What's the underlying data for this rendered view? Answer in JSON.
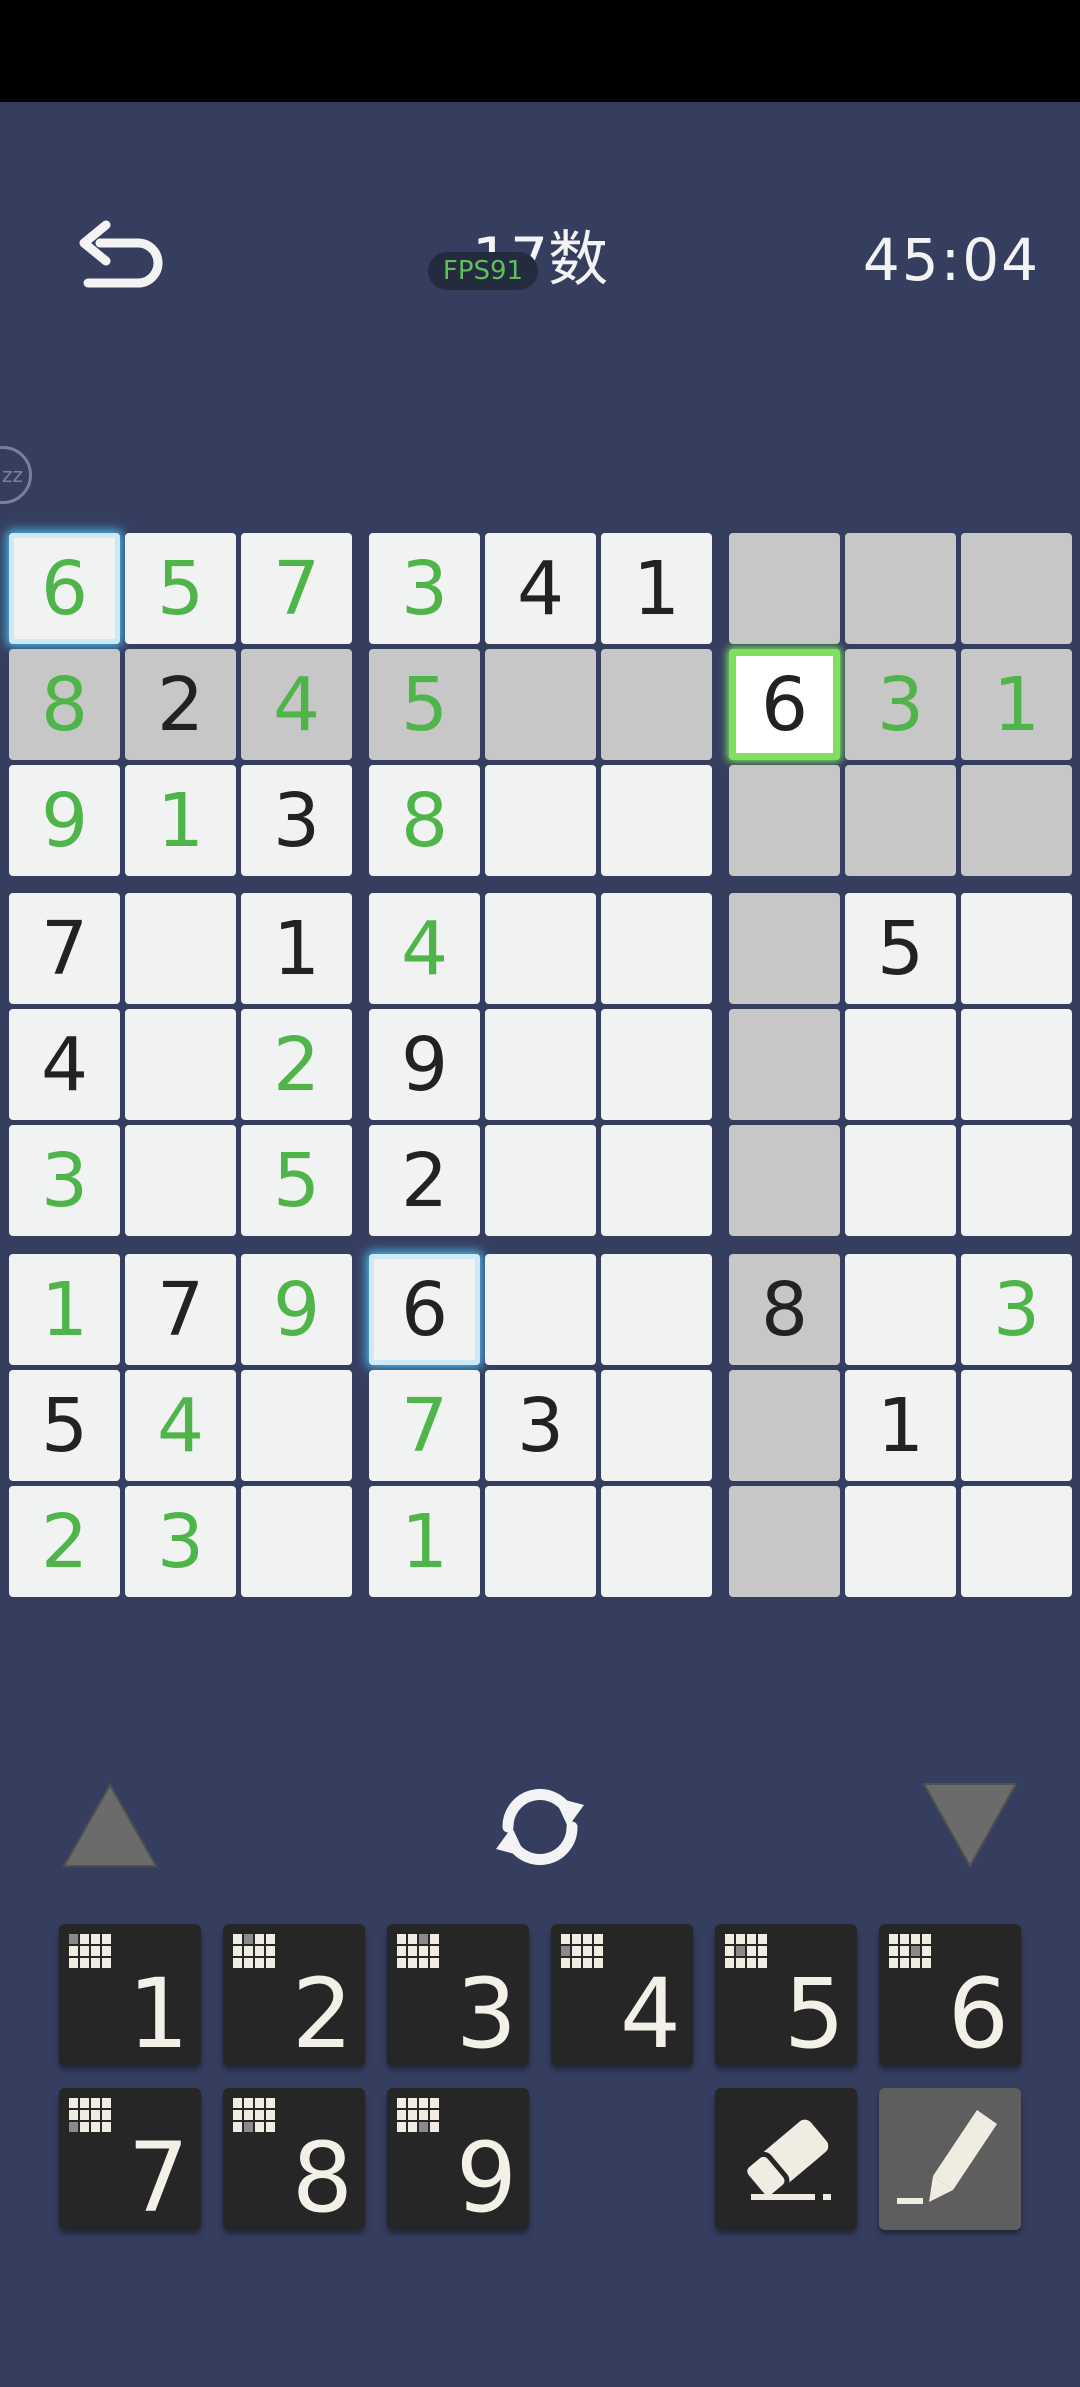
{
  "header": {
    "title": "17数",
    "fps": "FPS91",
    "timer": "45:04",
    "float_badge": "zz"
  },
  "board": {
    "rows": [
      [
        "6",
        "5",
        "7",
        "3",
        "4",
        "1",
        "",
        "",
        ""
      ],
      [
        "8",
        "2",
        "4",
        "5",
        "",
        "",
        "6",
        "3",
        "1"
      ],
      [
        "9",
        "1",
        "3",
        "8",
        "",
        "",
        "",
        "",
        ""
      ],
      [
        "7",
        "",
        "1",
        "4",
        "",
        "",
        "",
        "5",
        ""
      ],
      [
        "4",
        "",
        "2",
        "9",
        "",
        "",
        "",
        "",
        ""
      ],
      [
        "3",
        "",
        "5",
        "2",
        "",
        "",
        "",
        "",
        ""
      ],
      [
        "1",
        "7",
        "9",
        "6",
        "",
        "",
        "8",
        "",
        "3"
      ],
      [
        "5",
        "4",
        "",
        "7",
        "3",
        "",
        "",
        "1",
        ""
      ],
      [
        "2",
        "3",
        "",
        "1",
        "",
        "",
        "",
        "",
        ""
      ]
    ],
    "types": [
      [
        "u",
        "u",
        "u",
        "u",
        "g",
        "g",
        "",
        "",
        ""
      ],
      [
        "u",
        "g",
        "u",
        "u",
        "",
        "",
        "g",
        "u",
        "u"
      ],
      [
        "u",
        "u",
        "g",
        "u",
        "",
        "",
        "",
        "",
        ""
      ],
      [
        "g",
        "",
        "g",
        "u",
        "",
        "",
        "",
        "g",
        ""
      ],
      [
        "g",
        "",
        "u",
        "g",
        "",
        "",
        "",
        "",
        ""
      ],
      [
        "u",
        "",
        "u",
        "g",
        "",
        "",
        "",
        "",
        ""
      ],
      [
        "u",
        "g",
        "u",
        "g",
        "",
        "",
        "g",
        "",
        "u"
      ],
      [
        "g",
        "u",
        "",
        "u",
        "g",
        "",
        "",
        "g",
        ""
      ],
      [
        "u",
        "u",
        "",
        "u",
        "",
        "",
        "",
        "",
        ""
      ]
    ],
    "selected": [
      1,
      6
    ],
    "highlighted_digit": "6"
  },
  "controls": {
    "up_icon": "triangle-up-icon",
    "refresh_icon": "rotate-arrows-icon",
    "down_icon": "triangle-down-icon"
  },
  "keypad": {
    "digits": [
      "1",
      "2",
      "3",
      "4",
      "5",
      "6",
      "7",
      "8",
      "9"
    ],
    "eraser_icon": "eraser-icon",
    "pencil_icon": "pencil-icon",
    "pencil_active": true
  },
  "colors": {
    "background": "#363e60",
    "user_digit": "#4fb54a",
    "given_digit": "#222222",
    "cell": "#f1f2f2",
    "highlight_cell": "#c7c7c7",
    "selected_border": "#7ee05e"
  }
}
